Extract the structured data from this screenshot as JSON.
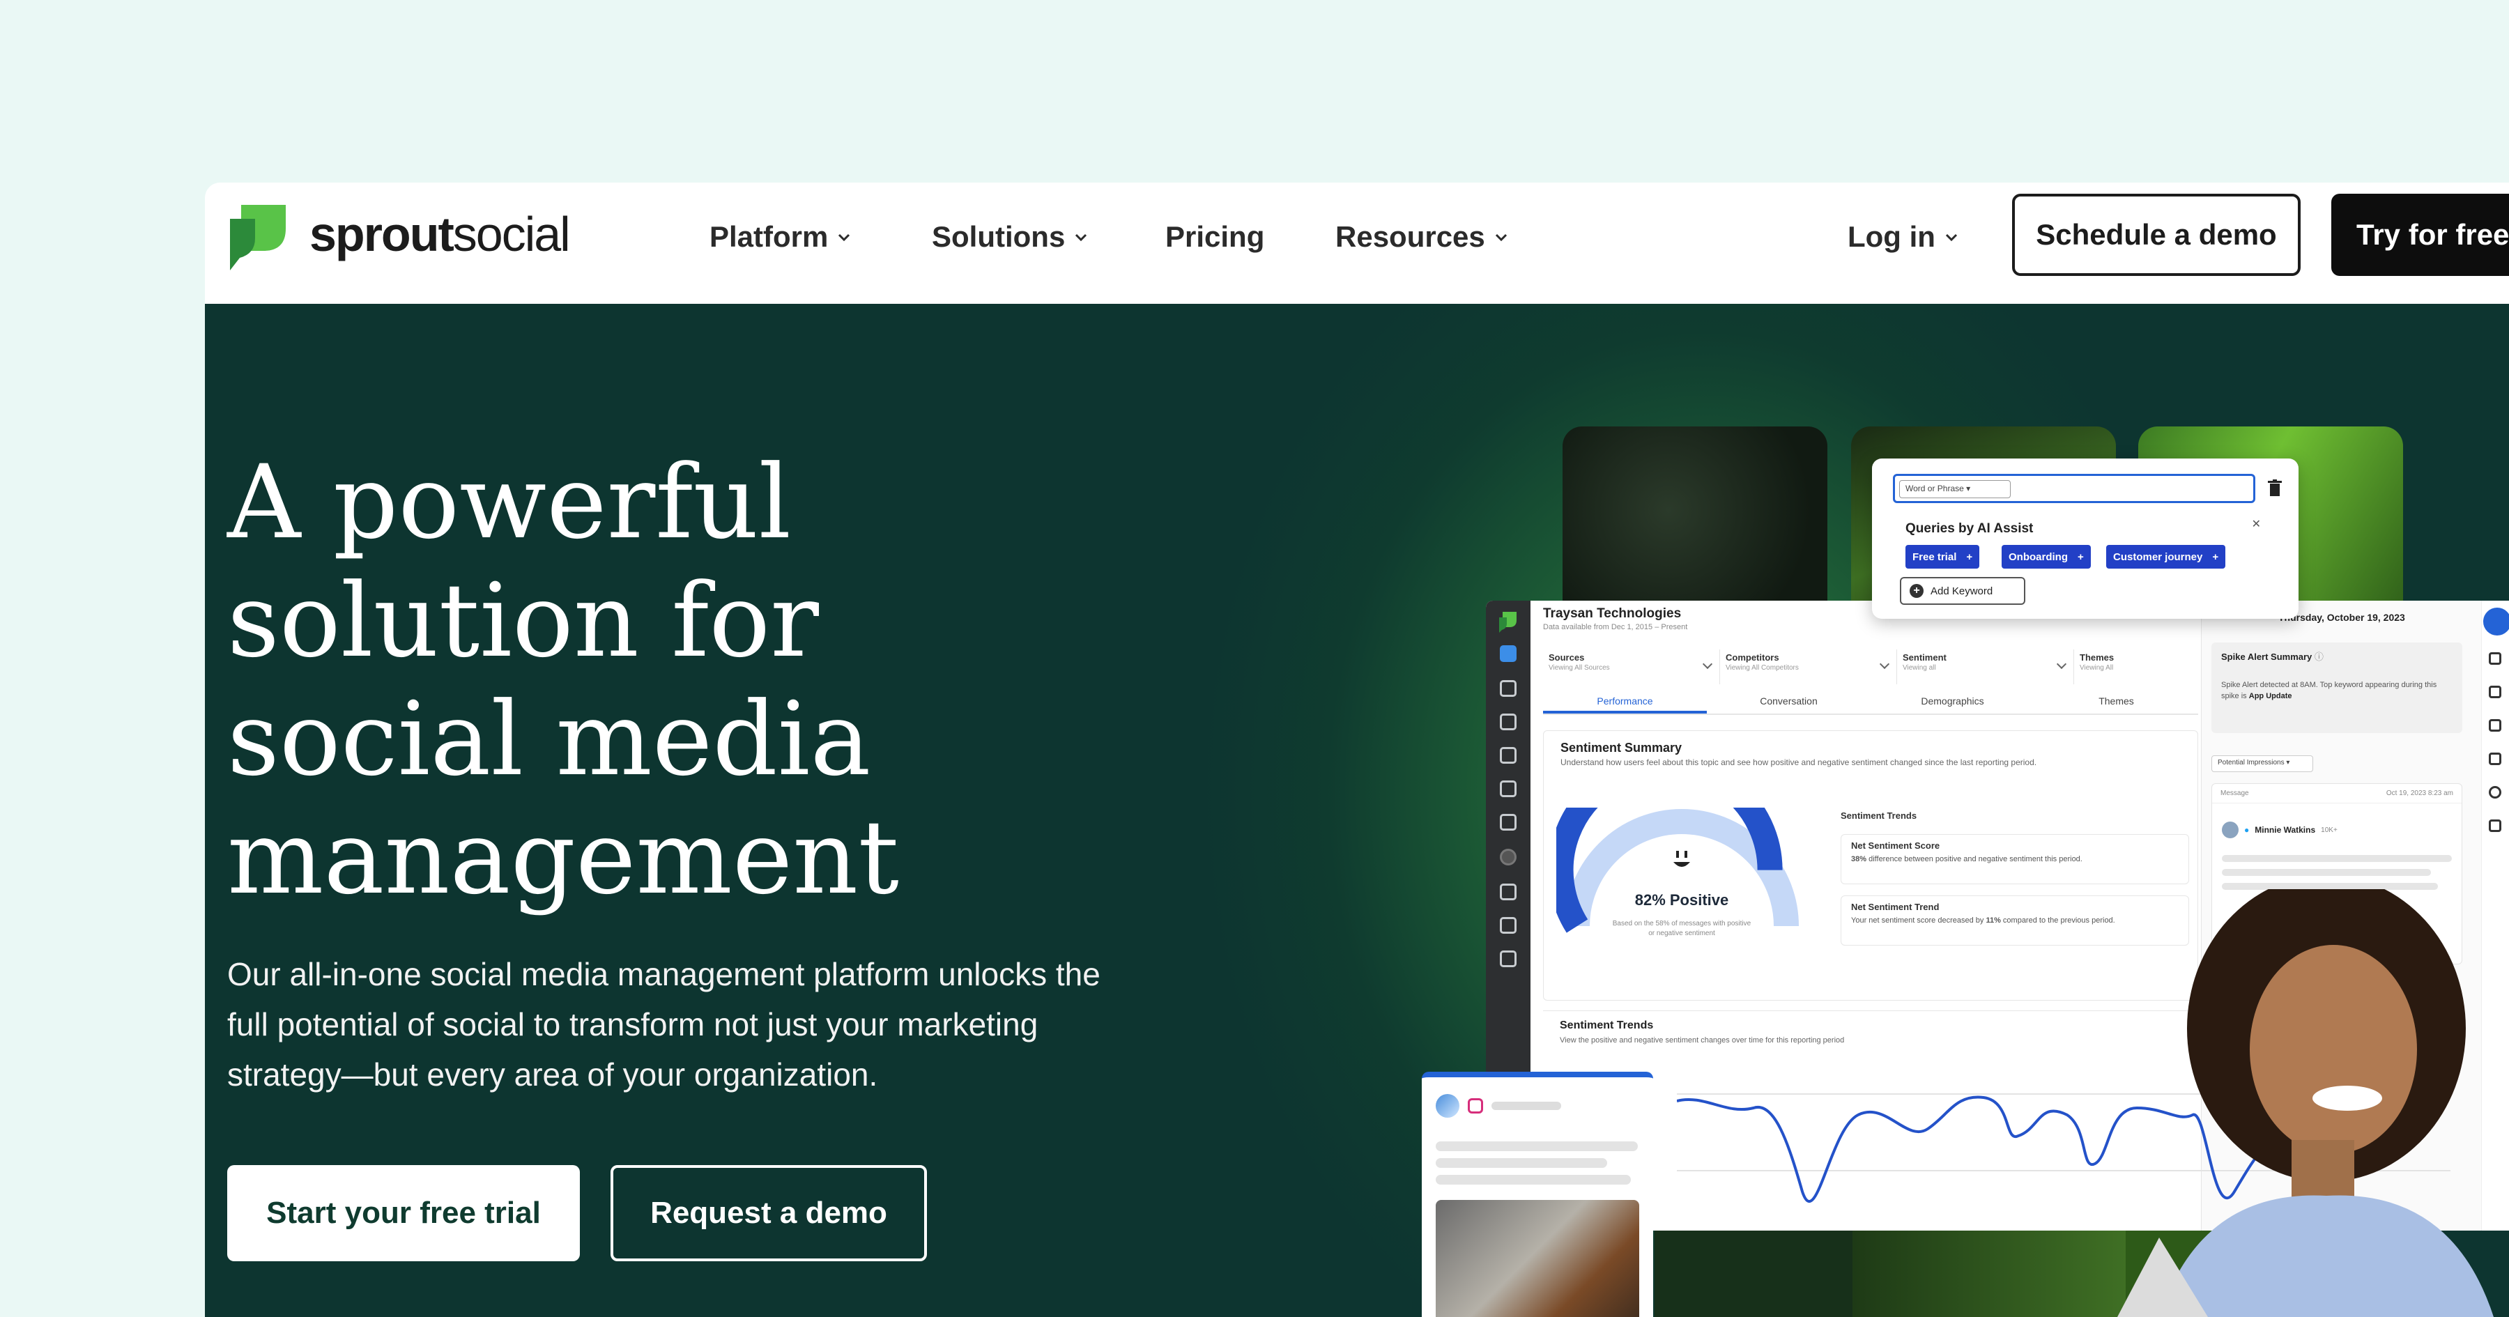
{
  "brand": {
    "name_bold": "sprout",
    "name_regular": "social",
    "accent": "#3b9c3b"
  },
  "nav": {
    "items": [
      {
        "label": "Platform",
        "has_menu": true
      },
      {
        "label": "Solutions",
        "has_menu": true
      },
      {
        "label": "Pricing",
        "has_menu": false
      },
      {
        "label": "Resources",
        "has_menu": true
      }
    ],
    "login": "Log in",
    "schedule_demo": "Schedule a demo",
    "try_free": "Try for free"
  },
  "hero": {
    "title": "A powerful solution for social media management",
    "subtitle": "Our all-in-one social media management platform unlocks the full potential of social to transform not just your marketing strategy—but every area of your organization.",
    "cta_primary": "Start your free trial",
    "cta_secondary": "Request a demo",
    "background": "#0d3530"
  },
  "popup": {
    "select_label": "Word or Phrase",
    "queries_title": "Queries by AI Assist",
    "chips": [
      "Free trial",
      "Onboarding",
      "Customer journey"
    ],
    "add_keyword": "Add Keyword"
  },
  "dashboard": {
    "company": "Traysan Technologies",
    "date_range": "Data available from Dec 1, 2015 – Present",
    "filters": [
      {
        "label": "Sources",
        "sub": "Viewing All Sources"
      },
      {
        "label": "Competitors",
        "sub": "Viewing All Competitors"
      },
      {
        "label": "Sentiment",
        "sub": "Viewing all"
      },
      {
        "label": "Themes",
        "sub": "Viewing All"
      }
    ],
    "tabs": [
      "Performance",
      "Conversation",
      "Demographics",
      "Themes"
    ],
    "sentiment_summary": {
      "title": "Sentiment Summary",
      "desc": "Understand how users feel about this topic and see how positive and negative sentiment changed since the last reporting period.",
      "gauge_value": "82% Positive",
      "gauge_fraction": 0.82,
      "gauge_note": "Based on the 58% of messages with positive or negative sentiment"
    },
    "sentiment_trends_label": "Sentiment Trends",
    "net_score": {
      "title": "Net Sentiment Score",
      "desc_bold": "38%",
      "desc": " difference between positive and negative sentiment this period."
    },
    "net_trend": {
      "title": "Net Sentiment Trend",
      "desc": "Your net sentiment score decreased by ",
      "desc_bold": "11%",
      "desc_end": " compared to the previous period."
    },
    "trend_section": {
      "title": "Sentiment Trends",
      "desc": "View the positive and negative sentiment changes over time for this reporting period"
    },
    "right_panel": {
      "date": "Thursday, October 19, 2023",
      "spike_title": "Spike Alert Summary",
      "spike_text": "Spike Alert detected at 8AM. Top keyword appearing during this spike is ",
      "spike_keyword": "App Update",
      "impressions_select": "Potential Impressions",
      "message_label": "Message",
      "message_date": "Oct 19, 2023 8:23 am",
      "author": "Minnie Watkins",
      "author_followers": "10K+"
    }
  }
}
